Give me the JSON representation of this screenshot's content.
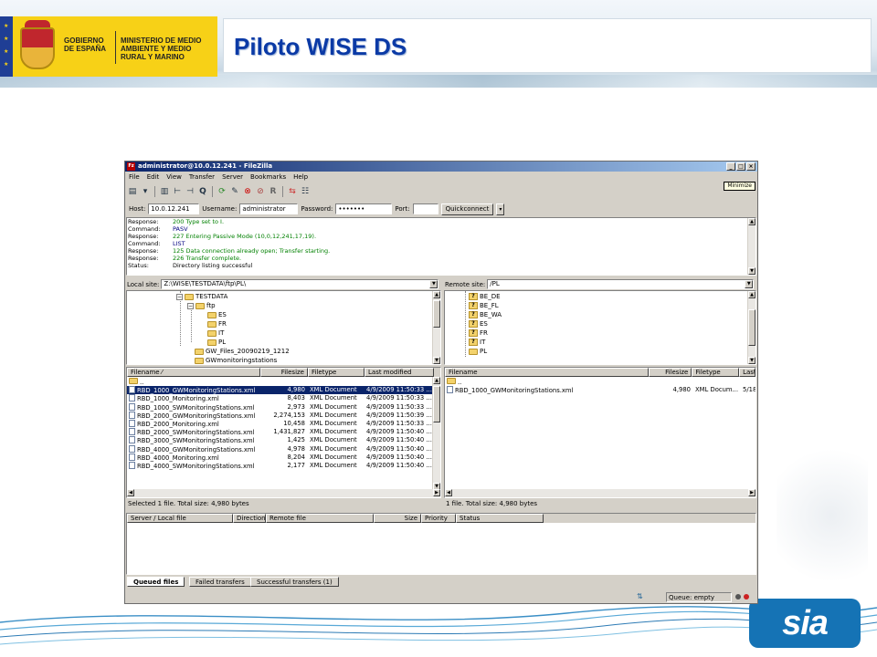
{
  "slide": {
    "title": "Piloto WISE DS",
    "gov_text": "GOBIERNO DE ESPAÑA",
    "ministry_text": "MINISTERIO DE MEDIO AMBIENTE Y MEDIO RURAL Y MARINO",
    "footer_logo": "sia"
  },
  "window": {
    "title": "administrator@10.0.12.241 - FileZilla",
    "app_icon": "Fz",
    "minimize_tooltip": "Minimize",
    "menu": [
      "File",
      "Edit",
      "View",
      "Transfer",
      "Server",
      "Bookmarks",
      "Help"
    ]
  },
  "quickconnect": {
    "host_label": "Host:",
    "host_value": "10.0.12.241",
    "user_label": "Username:",
    "user_value": "administrator",
    "pass_label": "Password:",
    "pass_value": "•••••••",
    "port_label": "Port:",
    "port_value": "",
    "button": "Quickconnect"
  },
  "log": [
    {
      "type": "Response:",
      "text": "200 Type set to I.",
      "color": "#008000"
    },
    {
      "type": "Command:",
      "text": "PASV",
      "color": "#000080"
    },
    {
      "type": "Response:",
      "text": "227 Entering Passive Mode (10,0,12,241,17,19).",
      "color": "#008000"
    },
    {
      "type": "Command:",
      "text": "LIST",
      "color": "#000080"
    },
    {
      "type": "Response:",
      "text": "125 Data connection already open; Transfer starting.",
      "color": "#008000"
    },
    {
      "type": "Response:",
      "text": "226 Transfer complete.",
      "color": "#008000"
    },
    {
      "type": "Status:",
      "text": "Directory listing successful",
      "color": "#000000"
    }
  ],
  "local": {
    "site_label": "Local site:",
    "site_path": "Z:\\WISE\\TESTDATA\\ftp\\PL\\",
    "tree": [
      "TESTDATA",
      "ftp",
      "ES",
      "FR",
      "IT",
      "PL",
      "GW_Files_20090219_1212",
      "GWmonitoringstations"
    ],
    "headers": [
      "Filename",
      "Filesize",
      "Filetype",
      "Last modified"
    ],
    "files": [
      {
        "name": "..",
        "size": "",
        "type": "",
        "modified": ""
      },
      {
        "name": "RBD_1000_GWMonitoringStations.xml",
        "size": "4,980",
        "type": "XML Document",
        "modified": "4/9/2009 11:50:33 ..."
      },
      {
        "name": "RBD_1000_Monitoring.xml",
        "size": "8,403",
        "type": "XML Document",
        "modified": "4/9/2009 11:50:33 ..."
      },
      {
        "name": "RBD_1000_SWMonitoringStations.xml",
        "size": "2,973",
        "type": "XML Document",
        "modified": "4/9/2009 11:50:33 ..."
      },
      {
        "name": "RBD_2000_GWMonitoringStations.xml",
        "size": "2,274,153",
        "type": "XML Document",
        "modified": "4/9/2009 11:50:39 ..."
      },
      {
        "name": "RBD_2000_Monitoring.xml",
        "size": "10,458",
        "type": "XML Document",
        "modified": "4/9/2009 11:50:33 ..."
      },
      {
        "name": "RBD_2000_SWMonitoringStations.xml",
        "size": "1,431,827",
        "type": "XML Document",
        "modified": "4/9/2009 11:50:40 ..."
      },
      {
        "name": "RBD_3000_SWMonitoringStations.xml",
        "size": "1,425",
        "type": "XML Document",
        "modified": "4/9/2009 11:50:40 ..."
      },
      {
        "name": "RBD_4000_GWMonitoringStations.xml",
        "size": "4,978",
        "type": "XML Document",
        "modified": "4/9/2009 11:50:40 ..."
      },
      {
        "name": "RBD_4000_Monitoring.xml",
        "size": "8,204",
        "type": "XML Document",
        "modified": "4/9/2009 11:50:40 ..."
      },
      {
        "name": "RBD_4000_SWMonitoringStations.xml",
        "size": "2,177",
        "type": "XML Document",
        "modified": "4/9/2009 11:50:40 ..."
      }
    ],
    "status": "Selected 1 file. Total size: 4,980 bytes"
  },
  "remote": {
    "site_label": "Remote site:",
    "site_path": "/PL",
    "tree": [
      "BE_DE",
      "BE_FL",
      "BE_WA",
      "ES",
      "FR",
      "IT",
      "PL"
    ],
    "headers": [
      "Filename",
      "Filesize",
      "Filetype",
      "Last"
    ],
    "files": [
      {
        "name": "..",
        "size": "",
        "type": "",
        "modified": ""
      },
      {
        "name": "RBD_1000_GWMonitoringStations.xml",
        "size": "4,980",
        "type": "XML Docum...",
        "modified": "5/18"
      }
    ],
    "status": "1 file. Total size: 4,980 bytes"
  },
  "queue": {
    "headers": [
      "Server / Local file",
      "Direction",
      "Remote file",
      "Size",
      "Priority",
      "Status"
    ],
    "tabs": [
      "Queued files",
      "Failed transfers",
      "Successful transfers (1)"
    ],
    "status": "Queue: empty"
  }
}
